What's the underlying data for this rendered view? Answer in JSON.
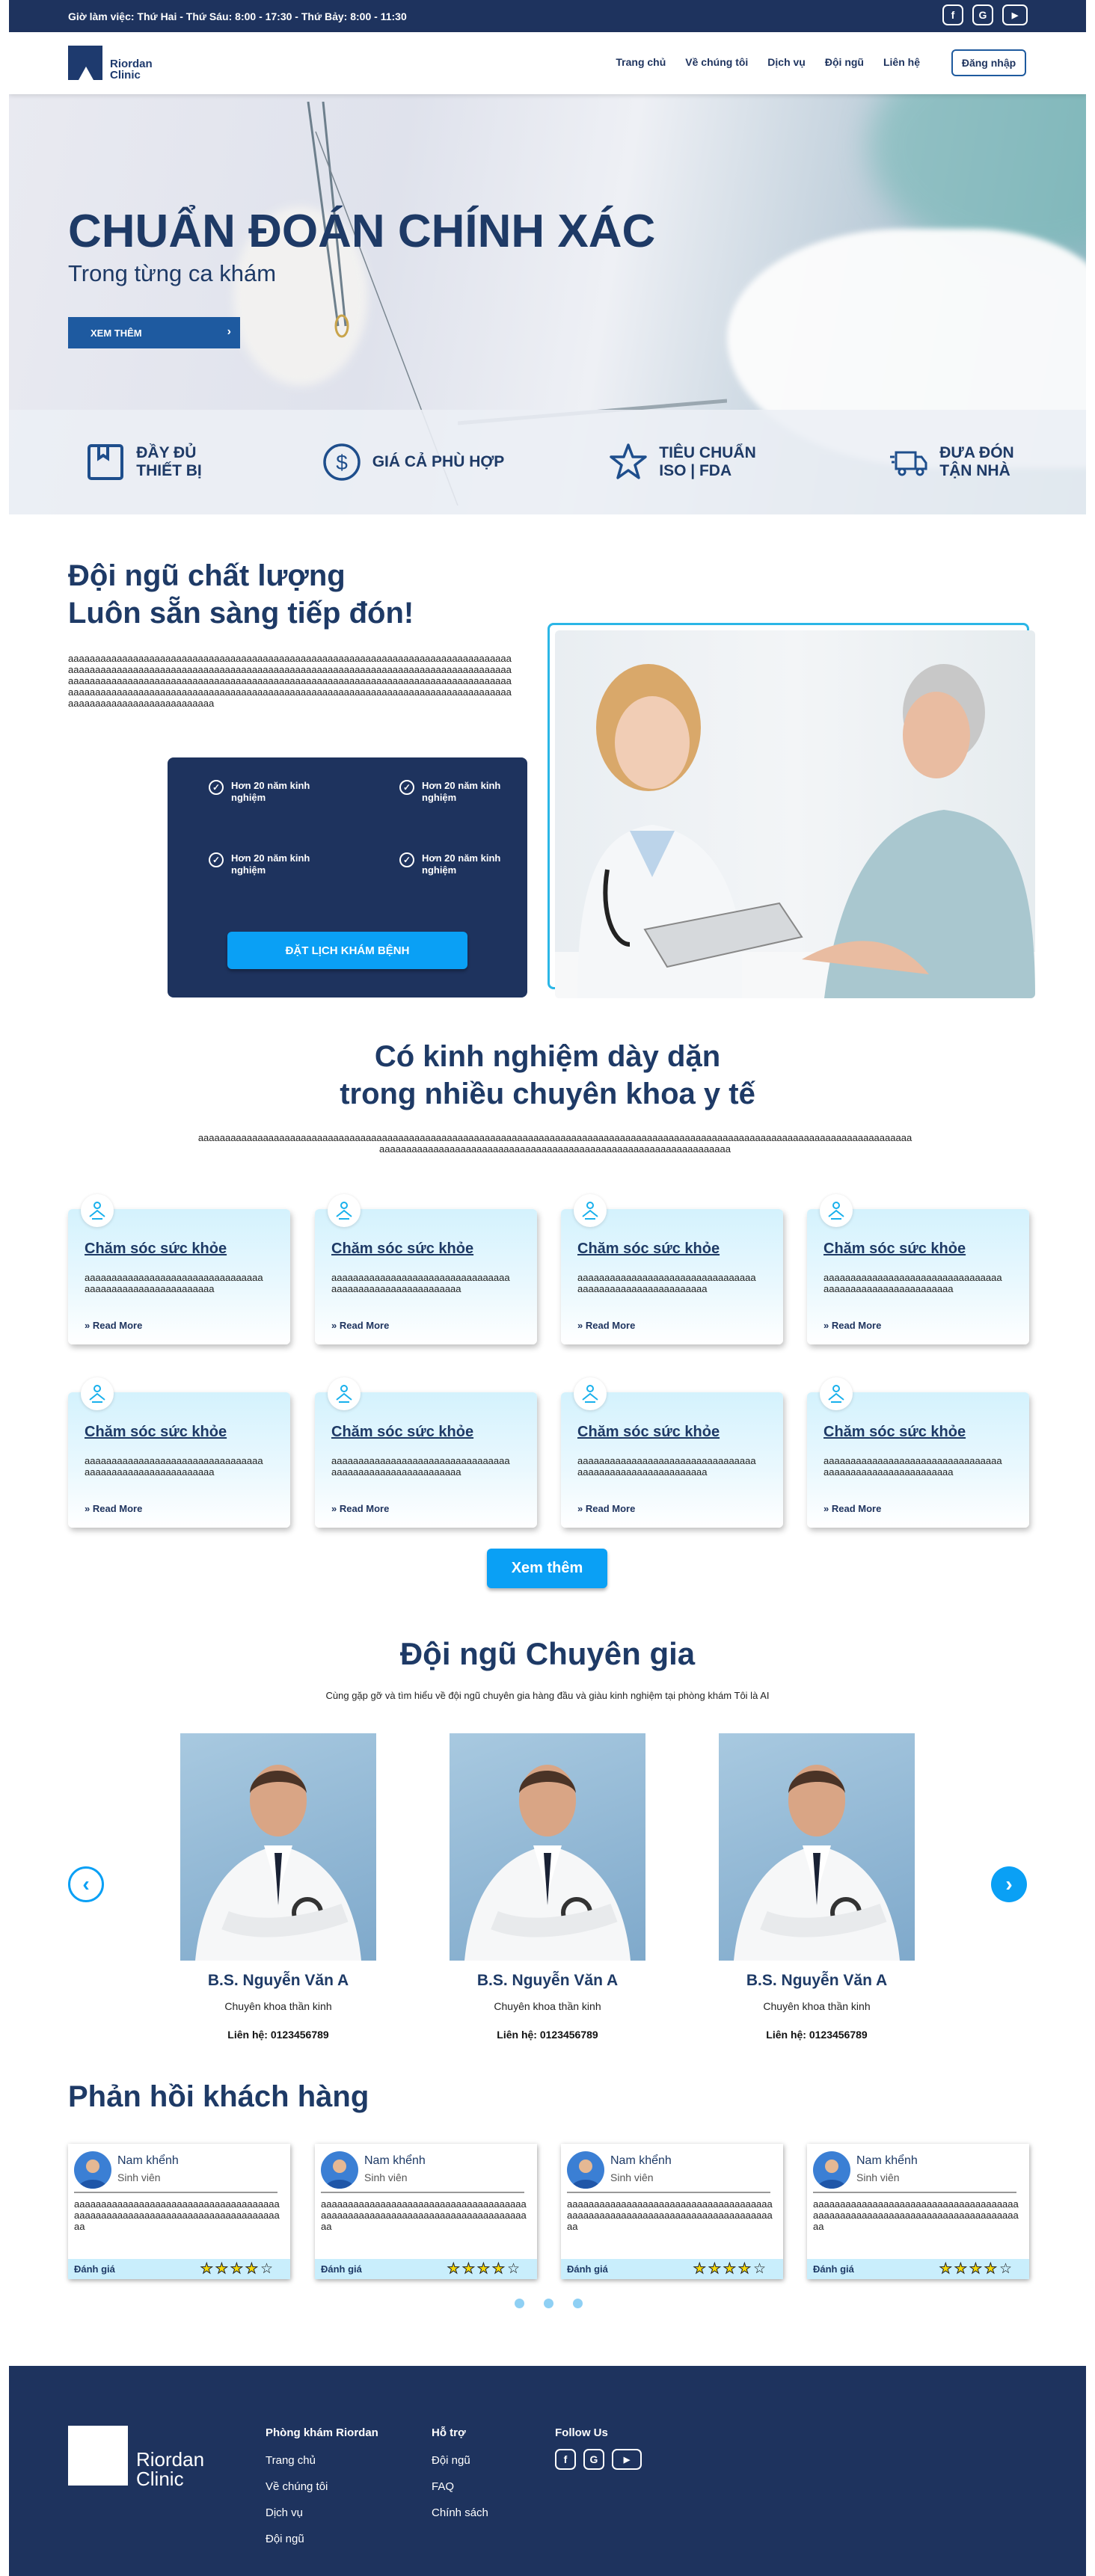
{
  "topbar": {
    "hours": "Giờ làm việc: Thứ Hai - Thứ Sáu: 8:00 - 17:30 - Thứ Bảy: 8:00 - 11:30",
    "social": [
      "f",
      "G",
      "▶"
    ]
  },
  "header": {
    "logo_line1": "Riordan",
    "logo_line2": "Clinic",
    "nav": [
      "Trang chủ",
      "Về chúng tôi",
      "Dịch vụ",
      "Đội ngũ",
      "Liên hệ"
    ],
    "login": "Đăng nhập"
  },
  "hero": {
    "title": "CHUẨN ĐOÁN CHÍNH XÁC",
    "subtitle": "Trong từng ca khám",
    "button": "XEM THÊM",
    "features": [
      {
        "icon": "box-icon",
        "line1": "ĐẦY ĐỦ",
        "line2": "THIẾT BỊ"
      },
      {
        "icon": "dollar-icon",
        "line1": "GIÁ CẢ PHÙ HỢP",
        "line2": ""
      },
      {
        "icon": "star-icon",
        "line1": "TIÊU CHUẨN",
        "line2": "ISO | FDA"
      },
      {
        "icon": "truck-icon",
        "line1": "ĐƯA ĐÓN",
        "line2": "TẬN NHÀ"
      }
    ]
  },
  "quality": {
    "title": "Đội ngũ chất lượng\nLuôn sẵn sàng tiếp đón!",
    "text": "aaaaaaaaaaaaaaaaaaaaaaaaaaaaaaaaaaaaaaaaaaaaaaaaaaaaaaaaaaaaaaaaaaaaaaaaaaaaaaaaaaaaaaaaaaaaaaaaaaaaaaaaaaaaaaaaaaaaaaaaaaaaaaaaaaaaaaaaaaaaaaaaaaaaaaaaaaaaaaaaaaaaaaaaaaaaaaaaaaaaaaaaaaaaaaaaaaaaaaaaaaaaaaaaaaaaaaaaaaaaaaaaaaaaaaaaaaaaaaaaaaaaaaaaaaaaaaaaaaaaaaaaaaaaaaaaaaaaaaaaaaaaaaaaaaaaaaaaaaaaaaaaaaaaaaaaaaaaaaaaaaaaaaaaaaaaaaaaaaaaaaaaaaaaaaaaaaa",
    "items": [
      "Hơn 20 năm kinh nghiệm",
      "Hơn 20 năm kinh nghiệm",
      "Hơn 20 năm kinh nghiệm",
      "Hơn 20 năm kinh nghiệm"
    ],
    "book": "ĐẶT LỊCH KHÁM BỆNH"
  },
  "specialties": {
    "title": "Có kinh nghiệm dày dặn\ntrong nhiều chuyên khoa y tế",
    "text": "aaaaaaaaaaaaaaaaaaaaaaaaaaaaaaaaaaaaaaaaaaaaaaaaaaaaaaaaaaaaaaaaaaaaaaaaaaaaaaaaaaaaaaaaaaaaaaaaaaaaaaaaaaaaaaaaaaaaaaaaaaaaaaaaaaaaaaaaaaaaaaaaaaaaaaaaaaaaaaaaaaaaaaaaaaaaaaaaaaaaaaaaaaaaaaaaaaaaa",
    "cards": [
      {
        "title": "Chăm sóc sức khỏe",
        "desc": "aaaaaaaaaaaaaaaaaaaaaaaaaaaaaaaaaaaaaaaaaaaaaaaaaaaaaaaaa",
        "link": "Read More"
      },
      {
        "title": "Chăm sóc sức khỏe",
        "desc": "aaaaaaaaaaaaaaaaaaaaaaaaaaaaaaaaaaaaaaaaaaaaaaaaaaaaaaaaa",
        "link": "Read More"
      },
      {
        "title": "Chăm sóc sức khỏe",
        "desc": "aaaaaaaaaaaaaaaaaaaaaaaaaaaaaaaaaaaaaaaaaaaaaaaaaaaaaaaaa",
        "link": "Read More"
      },
      {
        "title": "Chăm sóc sức khỏe",
        "desc": "aaaaaaaaaaaaaaaaaaaaaaaaaaaaaaaaaaaaaaaaaaaaaaaaaaaaaaaaa",
        "link": "Read More"
      },
      {
        "title": "Chăm sóc sức khỏe",
        "desc": "aaaaaaaaaaaaaaaaaaaaaaaaaaaaaaaaaaaaaaaaaaaaaaaaaaaaaaaaa",
        "link": "Read More"
      },
      {
        "title": "Chăm sóc sức khỏe",
        "desc": "aaaaaaaaaaaaaaaaaaaaaaaaaaaaaaaaaaaaaaaaaaaaaaaaaaaaaaaaa",
        "link": "Read More"
      },
      {
        "title": "Chăm sóc sức khỏe",
        "desc": "aaaaaaaaaaaaaaaaaaaaaaaaaaaaaaaaaaaaaaaaaaaaaaaaaaaaaaaaa",
        "link": "Read More"
      },
      {
        "title": "Chăm sóc sức khỏe",
        "desc": "aaaaaaaaaaaaaaaaaaaaaaaaaaaaaaaaaaaaaaaaaaaaaaaaaaaaaaaaa",
        "link": "Read More"
      }
    ],
    "more": "Xem thêm"
  },
  "experts": {
    "title": "Đội ngũ Chuyên gia",
    "subtitle": "Cùng gặp gỡ và tìm hiểu về đội ngũ chuyên gia hàng đầu và giàu kinh nghiệm tại phòng khám Tôi là AI",
    "doctors": [
      {
        "name": "B.S. Nguyễn Văn A",
        "specialty": "Chuyên khoa thần kinh",
        "contact": "Liên hệ: 0123456789"
      },
      {
        "name": "B.S. Nguyễn Văn A",
        "specialty": "Chuyên khoa thần kinh",
        "contact": "Liên hệ: 0123456789"
      },
      {
        "name": "B.S. Nguyễn Văn A",
        "specialty": "Chuyên khoa thần kinh",
        "contact": "Liên hệ: 0123456789"
      }
    ],
    "prev": "‹",
    "next": "›"
  },
  "feedback": {
    "title": "Phản hồi khách hàng",
    "cards": [
      {
        "name": "Nam khểnh",
        "role": "Sinh viên",
        "text": "aaaaaaaaaaaaaaaaaaaaaaaaaaaaaaaaaaaaaaaaaaaaaaaaaaaaaaaaaaaaaaaaaaaaaaaaaaaaaa",
        "rating_label": "Đánh giá",
        "rating": 4
      },
      {
        "name": "Nam khểnh",
        "role": "Sinh viên",
        "text": "aaaaaaaaaaaaaaaaaaaaaaaaaaaaaaaaaaaaaaaaaaaaaaaaaaaaaaaaaaaaaaaaaaaaaaaaaaaaaa",
        "rating_label": "Đánh giá",
        "rating": 4
      },
      {
        "name": "Nam khểnh",
        "role": "Sinh viên",
        "text": "aaaaaaaaaaaaaaaaaaaaaaaaaaaaaaaaaaaaaaaaaaaaaaaaaaaaaaaaaaaaaaaaaaaaaaaaaaaaaa",
        "rating_label": "Đánh giá",
        "rating": 4
      },
      {
        "name": "Nam khểnh",
        "role": "Sinh viên",
        "text": "aaaaaaaaaaaaaaaaaaaaaaaaaaaaaaaaaaaaaaaaaaaaaaaaaaaaaaaaaaaaaaaaaaaaaaaaaaaaaa",
        "rating_label": "Đánh giá",
        "rating": 4
      }
    ]
  },
  "footer": {
    "logo_line1": "Riordan",
    "logo_line2": "Clinic",
    "col1_title": "Phòng khám Riordan",
    "col1_links": [
      "Trang chủ",
      "Về chúng tôi",
      "Dịch vụ",
      "Đội ngũ"
    ],
    "col2_title": "Hỗ trợ",
    "col2_links": [
      "Đội ngũ",
      "FAQ",
      "Chính sách"
    ],
    "col3_title": "Follow Us",
    "social": [
      "f",
      "G",
      "▶"
    ]
  },
  "colors": {
    "navy": "#1e335e",
    "accent": "#0aa0f5",
    "heading": "#1e3a66"
  }
}
